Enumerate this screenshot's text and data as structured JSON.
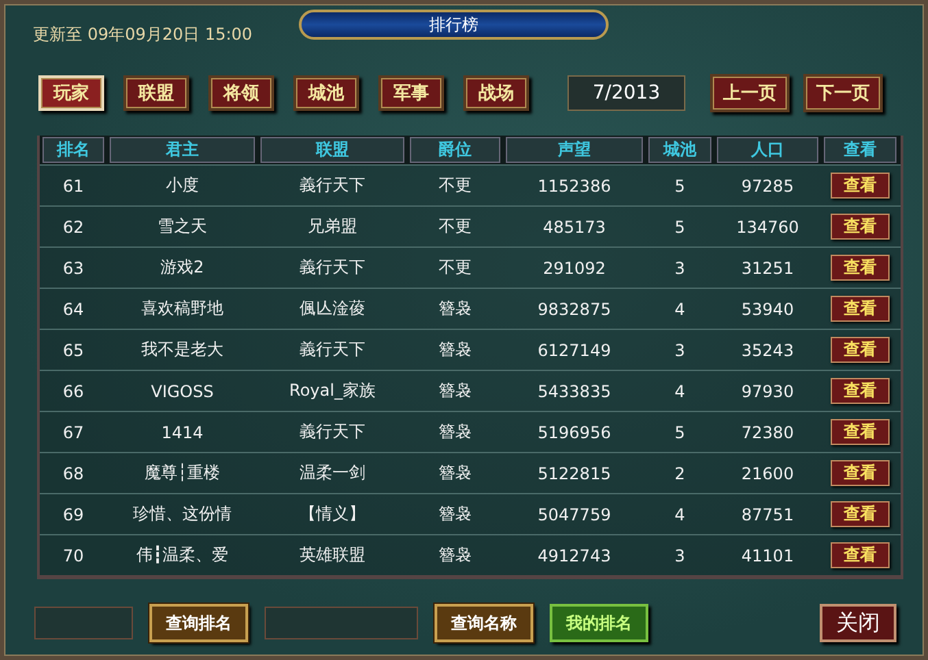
{
  "window": {
    "title": "排行榜"
  },
  "updated": "更新至 09年09月20日 15:00",
  "tabs": [
    {
      "label": "玩家",
      "selected": true
    },
    {
      "label": "联盟",
      "selected": false
    },
    {
      "label": "将领",
      "selected": false
    },
    {
      "label": "城池",
      "selected": false
    },
    {
      "label": "军事",
      "selected": false
    },
    {
      "label": "战场",
      "selected": false
    }
  ],
  "pager": {
    "page": "7/2013",
    "prev": "上一页",
    "next": "下一页"
  },
  "table": {
    "columns": [
      "排名",
      "君主",
      "联盟",
      "爵位",
      "声望",
      "城池",
      "人口",
      "查看"
    ],
    "rows": [
      [
        "61",
        "小度",
        "義行天下",
        "不更",
        "1152386",
        "5",
        "97285",
        "查看"
      ],
      [
        "62",
        "雪之天",
        "兄弟盟",
        "不更",
        "485173",
        "5",
        "134760",
        "查看"
      ],
      [
        "63",
        "游戏2",
        "義行天下",
        "不更",
        "291092",
        "3",
        "31251",
        "查看"
      ],
      [
        "64",
        "喜欢稿野地",
        "偑亾淦葰",
        "簪袅",
        "9832875",
        "4",
        "53940",
        "查看"
      ],
      [
        "65",
        "我不是老大",
        "義行天下",
        "簪袅",
        "6127149",
        "3",
        "35243",
        "查看"
      ],
      [
        "66",
        "VIGOSS",
        "Royal_家族",
        "簪袅",
        "5433835",
        "4",
        "97930",
        "查看"
      ],
      [
        "67",
        "1414",
        "義行天下",
        "簪袅",
        "5196956",
        "5",
        "72380",
        "查看"
      ],
      [
        "68",
        "魔尊┆重楼",
        "温柔一剑",
        "簪袅",
        "5122815",
        "2",
        "21600",
        "查看"
      ],
      [
        "69",
        "珍惜、这份情",
        "【情义】",
        "簪袅",
        "5047759",
        "4",
        "87751",
        "查看"
      ],
      [
        "70",
        "伟┇温柔、爱",
        "英雄联盟",
        "簪袅",
        "4912743",
        "3",
        "41101",
        "查看"
      ]
    ]
  },
  "footer": [
    {
      "kind": "field"
    },
    {
      "kind": "search",
      "label": "查询排名"
    },
    {
      "kind": "wide-field"
    },
    {
      "kind": "search",
      "label": "查询名称"
    },
    {
      "kind": "mine",
      "label": "我的排名"
    },
    {
      "kind": "close",
      "label": "关闭"
    }
  ]
}
